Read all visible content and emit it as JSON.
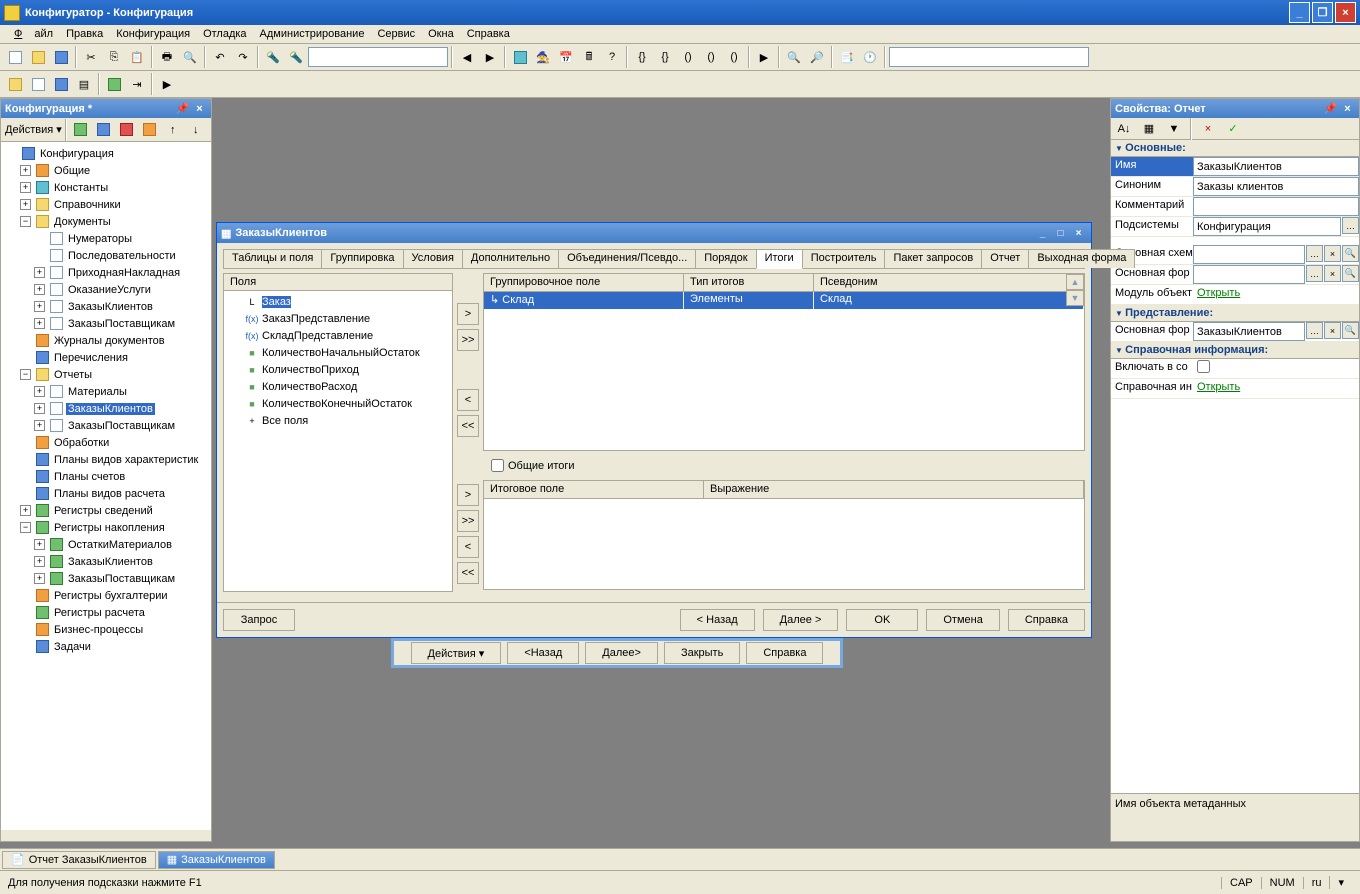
{
  "titlebar": {
    "text": "Конфигуратор - Конфигурация"
  },
  "menu": {
    "file": "Файл",
    "edit": "Правка",
    "config": "Конфигурация",
    "debug": "Отладка",
    "admin": "Администрирование",
    "service": "Сервис",
    "windows": "Окна",
    "help": "Справка"
  },
  "configPanel": {
    "title": "Конфигурация *",
    "actions": "Действия",
    "tree": [
      {
        "l": 1,
        "exp": "",
        "ico": "blue",
        "txt": "Конфигурация"
      },
      {
        "l": 2,
        "exp": "+",
        "ico": "orange",
        "txt": "Общие"
      },
      {
        "l": 2,
        "exp": "+",
        "ico": "cyan",
        "txt": "Константы"
      },
      {
        "l": 2,
        "exp": "+",
        "ico": "folder",
        "txt": "Справочники"
      },
      {
        "l": 2,
        "exp": "−",
        "ico": "folder",
        "txt": "Документы"
      },
      {
        "l": 3,
        "exp": "",
        "ico": "doc",
        "txt": "Нумераторы"
      },
      {
        "l": 3,
        "exp": "",
        "ico": "doc",
        "txt": "Последовательности"
      },
      {
        "l": 3,
        "exp": "+",
        "ico": "doc",
        "txt": "ПриходнаяНакладная"
      },
      {
        "l": 3,
        "exp": "+",
        "ico": "doc",
        "txt": "ОказаниеУслуги"
      },
      {
        "l": 3,
        "exp": "+",
        "ico": "doc",
        "txt": "ЗаказыКлиентов"
      },
      {
        "l": 3,
        "exp": "+",
        "ico": "doc",
        "txt": "ЗаказыПоставщикам"
      },
      {
        "l": 2,
        "exp": "",
        "ico": "orange",
        "txt": "Журналы документов"
      },
      {
        "l": 2,
        "exp": "",
        "ico": "blue",
        "txt": "Перечисления"
      },
      {
        "l": 2,
        "exp": "−",
        "ico": "folder",
        "txt": "Отчеты"
      },
      {
        "l": 3,
        "exp": "+",
        "ico": "doc",
        "txt": "Материалы"
      },
      {
        "l": 3,
        "exp": "+",
        "ico": "doc",
        "txt": "ЗаказыКлиентов",
        "sel": true
      },
      {
        "l": 3,
        "exp": "+",
        "ico": "doc",
        "txt": "ЗаказыПоставщикам"
      },
      {
        "l": 2,
        "exp": "",
        "ico": "orange",
        "txt": "Обработки"
      },
      {
        "l": 2,
        "exp": "",
        "ico": "blue",
        "txt": "Планы видов характеристик"
      },
      {
        "l": 2,
        "exp": "",
        "ico": "blue",
        "txt": "Планы счетов"
      },
      {
        "l": 2,
        "exp": "",
        "ico": "blue",
        "txt": "Планы видов расчета"
      },
      {
        "l": 2,
        "exp": "+",
        "ico": "green",
        "txt": "Регистры сведений"
      },
      {
        "l": 2,
        "exp": "−",
        "ico": "green",
        "txt": "Регистры накопления"
      },
      {
        "l": 3,
        "exp": "+",
        "ico": "green",
        "txt": "ОстаткиМатериалов"
      },
      {
        "l": 3,
        "exp": "+",
        "ico": "green",
        "txt": "ЗаказыКлиентов"
      },
      {
        "l": 3,
        "exp": "+",
        "ico": "green",
        "txt": "ЗаказыПоставщикам"
      },
      {
        "l": 2,
        "exp": "",
        "ico": "orange",
        "txt": "Регистры бухгалтерии"
      },
      {
        "l": 2,
        "exp": "",
        "ico": "green",
        "txt": "Регистры расчета"
      },
      {
        "l": 2,
        "exp": "",
        "ico": "orange",
        "txt": "Бизнес-процессы"
      },
      {
        "l": 2,
        "exp": "",
        "ico": "blue",
        "txt": "Задачи"
      }
    ]
  },
  "props": {
    "title": "Свойства: Отчет",
    "groups": {
      "main": "Основные:",
      "present": "Представление:",
      "help": "Справочная информация:"
    },
    "rows": {
      "name_l": "Имя",
      "name_v": "ЗаказыКлиентов",
      "synonym_l": "Синоним",
      "synonym_v": "Заказы клиентов",
      "comment_l": "Комментарий",
      "comment_v": "",
      "subsys_l": "Подсистемы",
      "subsys_v": "Конфигурация",
      "mainschema_l": "Основная схем",
      "mainschema_v": "",
      "mainform_l": "Основная фор",
      "mainform_v": "",
      "module_l": "Модуль объект",
      "module_v": "Открыть",
      "mainform2_l": "Основная фор",
      "mainform2_v": "ЗаказыКлиентов",
      "include_l": "Включать в со",
      "helpinfo_l": "Справочная ин",
      "helpinfo_v": "Открыть"
    },
    "desc": "Имя объекта метаданных"
  },
  "dialog": {
    "title": "ЗаказыКлиентов",
    "tabs": [
      "Таблицы и поля",
      "Группировка",
      "Условия",
      "Дополнительно",
      "Объединения/Псевдо...",
      "Порядок",
      "Итоги",
      "Построитель",
      "Пакет запросов",
      "Отчет",
      "Выходная форма"
    ],
    "activeTab": 6,
    "fieldsHeader": "Поля",
    "fields": [
      {
        "ico": "L",
        "txt": "Заказ",
        "sel": true
      },
      {
        "ico": "f(x)",
        "txt": "ЗаказПредставление"
      },
      {
        "ico": "f(x)",
        "txt": "СкладПредставление"
      },
      {
        "ico": "■",
        "txt": "КоличествоНачальныйОстаток"
      },
      {
        "ico": "■",
        "txt": "КоличествоПриход"
      },
      {
        "ico": "■",
        "txt": "КоличествоРасход"
      },
      {
        "ico": "■",
        "txt": "КоличествоКонечныйОстаток"
      },
      {
        "ico": "+",
        "txt": "Все поля"
      }
    ],
    "groupGrid": {
      "headers": [
        "Группировочное поле",
        "Тип итогов",
        "Псевдоним"
      ],
      "row": [
        "Склад",
        "Элементы",
        "Склад"
      ]
    },
    "overallTotals": "Общие итоги",
    "totalsGrid": {
      "headers": [
        "Итоговое поле",
        "Выражение"
      ]
    },
    "moveBtns": [
      ">",
      ">>",
      "<",
      "<<"
    ],
    "buttons": {
      "query": "Запрос",
      "back": "< Назад",
      "next": "Далее >",
      "ok": "OK",
      "cancel": "Отмена",
      "help": "Справка"
    }
  },
  "behind": {
    "actions": "Действия",
    "back": "<Назад",
    "next": "Далее>",
    "close": "Закрыть",
    "help": "Справка"
  },
  "taskbar": {
    "item1": "Отчет ЗаказыКлиентов",
    "item2": "ЗаказыКлиентов"
  },
  "statusbar": {
    "hint": "Для получения подсказки нажмите F1",
    "cap": "CAP",
    "num": "NUM",
    "lang": "ru"
  }
}
